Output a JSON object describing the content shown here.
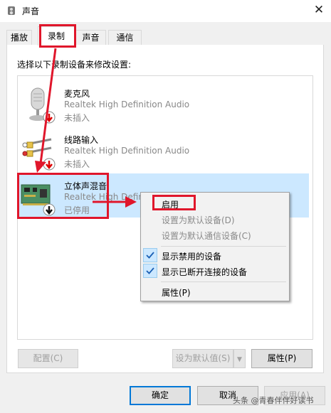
{
  "window": {
    "title": "声音",
    "close_icon": "close-icon",
    "speaker_icon": "speaker-icon"
  },
  "tabs": [
    {
      "label": "播放",
      "active": false
    },
    {
      "label": "录制",
      "active": true
    },
    {
      "label": "声音",
      "active": false
    },
    {
      "label": "通信",
      "active": false
    }
  ],
  "instruction": "选择以下录制设备来修改设置:",
  "devices": [
    {
      "name": "麦克风",
      "driver": "Realtek High Definition Audio",
      "status": "未插入",
      "icon": "microphone-icon"
    },
    {
      "name": "线路输入",
      "driver": "Realtek High Definition Audio",
      "status": "未插入",
      "icon": "line-in-icon"
    },
    {
      "name": "立体声混音",
      "driver": "Realtek High Definition Audio",
      "status": "已停用",
      "icon": "sound-card-icon",
      "selected": true
    }
  ],
  "context_menu": {
    "items": [
      {
        "label": "启用",
        "enabled": true,
        "checked": false
      },
      {
        "label": "设置为默认设备(D)",
        "enabled": false,
        "checked": false
      },
      {
        "label": "设置为默认通信设备(C)",
        "enabled": false,
        "checked": false
      },
      {
        "label": "显示禁用的设备",
        "enabled": true,
        "checked": true
      },
      {
        "label": "显示已断开连接的设备",
        "enabled": true,
        "checked": true
      },
      {
        "label": "属性(P)",
        "enabled": true,
        "checked": false
      }
    ]
  },
  "buttons": {
    "configure": "配置(C)",
    "set_default": "设为默认值(S)",
    "properties": "属性(P)",
    "ok": "确定",
    "cancel": "取消",
    "apply": "应用(A)"
  },
  "colors": {
    "highlight": "#e0162b",
    "selection": "#cce8ff",
    "accent": "#0078d7"
  }
}
